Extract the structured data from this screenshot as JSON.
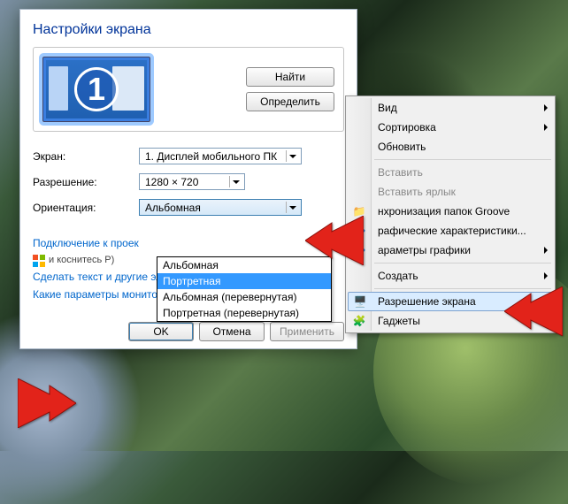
{
  "dialog": {
    "title": "Настройки экрана",
    "detect": "Найти",
    "identify": "Определить",
    "monitor_number": "1",
    "screen_label": "Экран:",
    "screen_value": "1. Дисплей мобильного ПК",
    "resolution_label": "Разрешение:",
    "resolution_value": "1280 × 720",
    "orientation_label": "Ориентация:",
    "orientation_value": "Альбомная",
    "orientation_options": [
      "Альбомная",
      "Портретная",
      "Альбомная (перевернутая)",
      "Портретная (перевернутая)"
    ],
    "projector_link": "Подключение к проек",
    "projector_sub": "и коснитесь P)",
    "text_size_link": "Сделать текст и другие элементы больше или меньше",
    "help_link": "Какие параметры монитора следует выбрать?",
    "ok": "OK",
    "cancel": "Отмена",
    "apply": "Применить"
  },
  "menu": {
    "view": "Вид",
    "sort": "Сортировка",
    "refresh": "Обновить",
    "paste": "Вставить",
    "paste_shortcut": "Вставить ярлык",
    "groove": "нхронизация папок Groove",
    "graphics_props": "рафические характеристики...",
    "graphics_opts": "араметры графики",
    "new": "Создать",
    "resolution": "Разрешение экрана",
    "gadgets": "Гаджеты"
  }
}
